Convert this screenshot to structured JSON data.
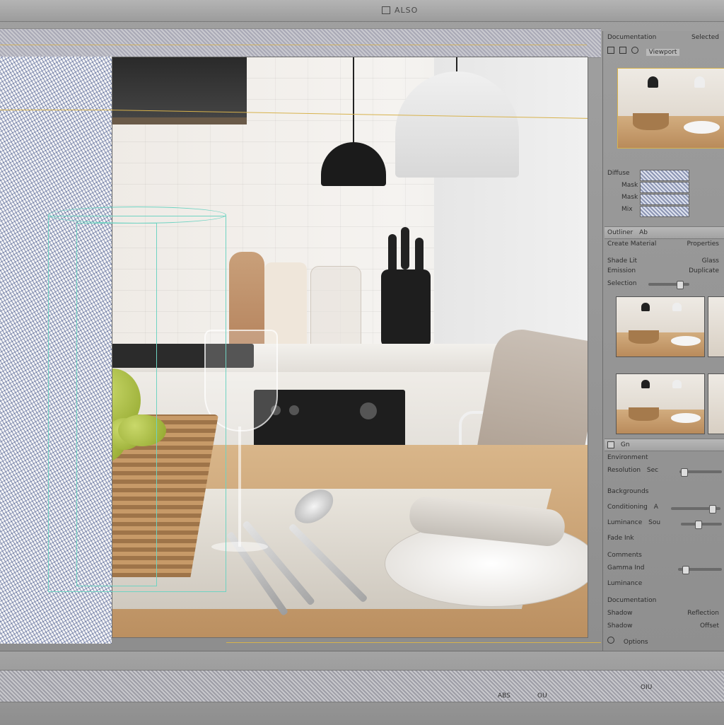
{
  "app": {
    "title": "ALSO",
    "accent_color": "#d7b24c",
    "gizmo_color": "#6fd3c2"
  },
  "right_panel": {
    "header": {
      "left": "Documentation",
      "right": "Selected"
    },
    "tabs": [
      "Viewport"
    ],
    "icons": [
      "grid-icon",
      "camera-icon",
      "light-icon",
      "layer-icon"
    ],
    "swatch_rows": [
      "Diffuse",
      "Mask",
      "Mask",
      "Mix"
    ],
    "section_material": {
      "label": "Outliner",
      "value": "Ab"
    },
    "material_rows": [
      {
        "label": "Create Material",
        "value": "Properties"
      },
      {
        "label": "Shade Lit",
        "value": "Glass"
      },
      {
        "label": "Emission",
        "value": "Duplicate"
      },
      {
        "label": "Selection",
        "value": ""
      }
    ],
    "section_render": {
      "label": "Gn"
    },
    "render_rows": [
      {
        "label": "Environment",
        "value": ""
      },
      {
        "label": "Resolution",
        "value": "Sec"
      },
      {
        "label": "Backgrounds",
        "value": ""
      },
      {
        "label": "Conditioning",
        "value": "A"
      },
      {
        "label": "Luminance",
        "value": "Sou"
      },
      {
        "label": "Fade Ink",
        "value": ""
      },
      {
        "label": "Comments",
        "value": ""
      },
      {
        "label": "Gamma Ind",
        "value": ""
      },
      {
        "label": "Luminance",
        "value": ""
      }
    ],
    "footer_rows": [
      {
        "label": "Documentation",
        "value": ""
      },
      {
        "label": "Shadow",
        "value": "Reflection"
      },
      {
        "label": "Shadow",
        "value": "Offset"
      },
      {
        "label": "Options",
        "value": ""
      }
    ]
  },
  "bottom": {
    "labels": [
      "ABS",
      "OU",
      "OIU"
    ]
  }
}
